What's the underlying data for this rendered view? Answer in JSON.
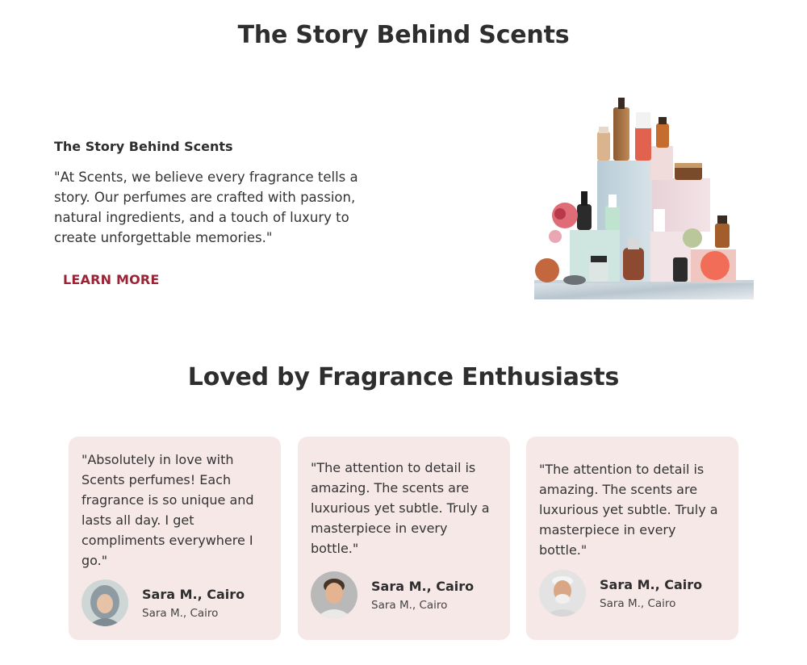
{
  "story": {
    "section_title": "The Story Behind Scents",
    "subtitle": "The Story Behind Scents",
    "quote": "\"At Scents, we believe every fragrance tells a story. Our perfumes are crafted with passion, natural ingredients, and a touch of luxury to create unforgettable memories.\"",
    "learn_more": "LEARN MORE",
    "image_subject": "perfume-bottles-on-marble-display"
  },
  "testimonials": {
    "title": "Loved by Fragrance Enthusiasts",
    "cards": [
      {
        "quote": "\"Absolutely in love with Scents perfumes! Each fragrance is so unique and lasts all day. I get compliments everywhere I go.\"",
        "name": "Sara M., Cairo",
        "place": "Sara M., Cairo",
        "avatar": "woman-in-hijab-avatar"
      },
      {
        "quote": "\"The attention to detail is amazing. The scents are luxurious yet subtle. Truly a masterpiece in every bottle.\"",
        "name": "Sara M., Cairo",
        "place": "Sara M., Cairo",
        "avatar": "smiling-man-avatar"
      },
      {
        "quote": "\"The attention to detail is amazing. The scents are luxurious yet subtle. Truly a masterpiece in every bottle.\"",
        "name": "Sara M., Cairo",
        "place": "Sara M., Cairo",
        "avatar": "older-man-avatar"
      }
    ]
  },
  "colors": {
    "accent": "#9b2335",
    "card_bg": "#f7e8e8",
    "text": "#2e2e2e"
  }
}
